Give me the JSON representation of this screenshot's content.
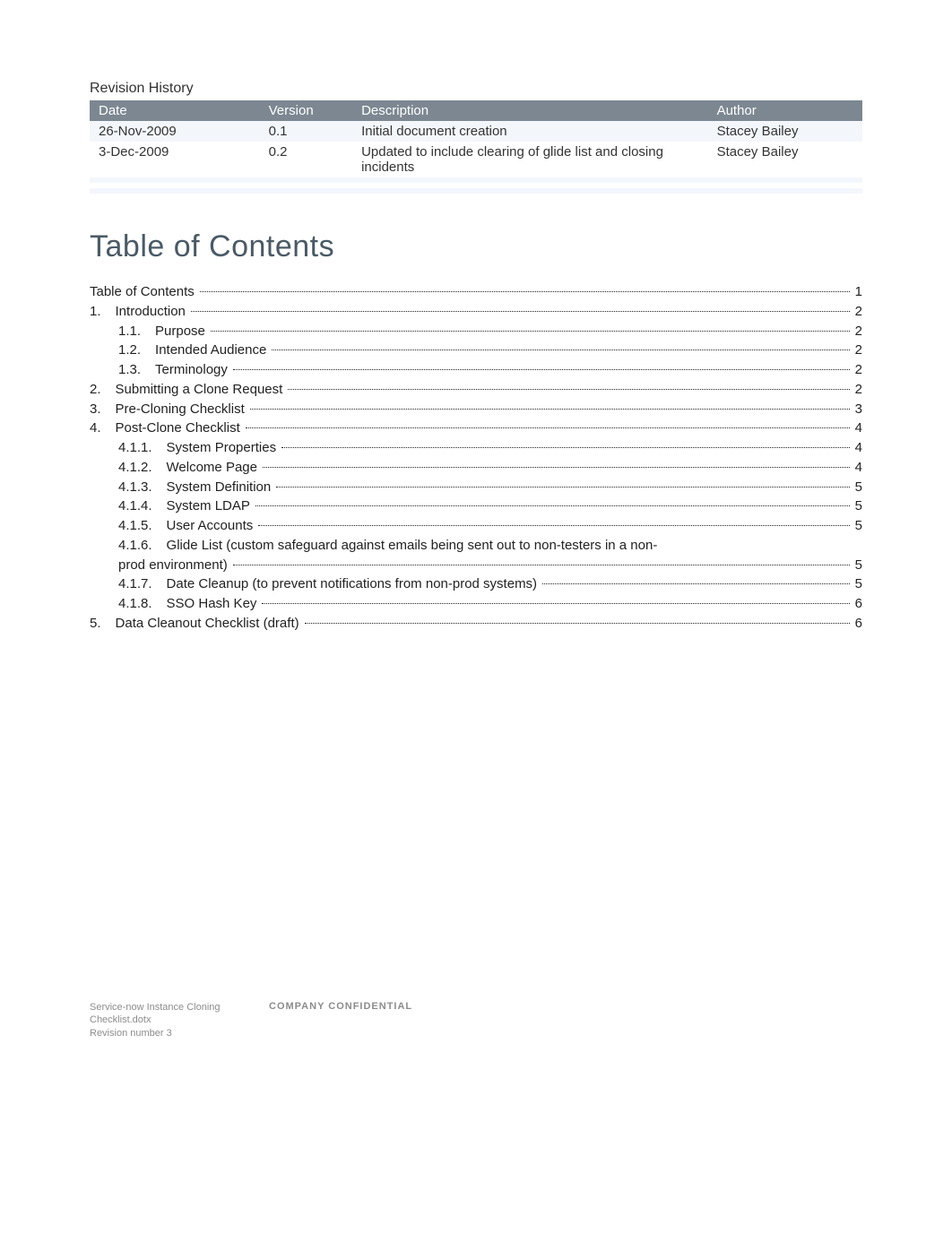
{
  "revision": {
    "title": "Revision History",
    "headers": {
      "date": "Date",
      "version": "Version",
      "description": "Description",
      "author": "Author"
    },
    "rows": [
      {
        "date": "26-Nov-2009",
        "version": "0.1",
        "description": "Initial document creation",
        "author": "Stacey Bailey"
      },
      {
        "date": "3-Dec-2009",
        "version": "0.2",
        "description": "Updated to include clearing of glide list and closing incidents",
        "author": "Stacey Bailey"
      },
      {
        "date": "",
        "version": "",
        "description": "",
        "author": ""
      },
      {
        "date": "",
        "version": "",
        "description": "",
        "author": ""
      },
      {
        "date": "",
        "version": "",
        "description": "",
        "author": ""
      }
    ]
  },
  "tocHeading": "Table of Contents",
  "toc": [
    {
      "indent": 1,
      "num": "",
      "text": "Table of Contents",
      "page": "1"
    },
    {
      "indent": 1,
      "num": "1.",
      "text": "Introduction",
      "page": "2"
    },
    {
      "indent": 2,
      "num": "1.1.",
      "text": "Purpose",
      "page": "2"
    },
    {
      "indent": 2,
      "num": "1.2.",
      "text": "Intended Audience",
      "page": "2"
    },
    {
      "indent": 2,
      "num": "1.3.",
      "text": "Terminology",
      "page": "2"
    },
    {
      "indent": 1,
      "num": "2.",
      "text": "Submitting a Clone Request",
      "page": "2"
    },
    {
      "indent": 1,
      "num": "3.",
      "text": "Pre-Cloning Checklist",
      "page": "3"
    },
    {
      "indent": 1,
      "num": "4.",
      "text": "Post-Clone Checklist",
      "page": "4"
    },
    {
      "indent": 3,
      "num": "4.1.1.",
      "text": "System Properties",
      "page": "4"
    },
    {
      "indent": 3,
      "num": "4.1.2.",
      "text": "Welcome Page",
      "page": "4"
    },
    {
      "indent": 3,
      "num": "4.1.3.",
      "text": "System Definition",
      "page": "5"
    },
    {
      "indent": 3,
      "num": "4.1.4.",
      "text": "System LDAP",
      "page": "5"
    },
    {
      "indent": 3,
      "num": "4.1.5.",
      "text": "User Accounts",
      "page": "5"
    },
    {
      "indent": 3,
      "num": "4.1.6.",
      "text": "Glide List (custom safeguard against emails being sent out to non-testers in a non-prod environment)",
      "page": "5",
      "wrap": true
    },
    {
      "indent": 3,
      "num": "4.1.7.",
      "text": "Date Cleanup (to prevent notifications from non-prod systems)",
      "page": "5"
    },
    {
      "indent": 3,
      "num": "4.1.8.",
      "text": "SSO Hash Key",
      "page": "6"
    },
    {
      "indent": 1,
      "num": "5.",
      "text": "Data Cleanout Checklist (draft)",
      "page": "6"
    }
  ],
  "footer": {
    "line1": "Service-now Instance Cloning Checklist.dotx",
    "line2": "Revision number 3",
    "center": "COMPANY CONFIDENTIAL"
  }
}
